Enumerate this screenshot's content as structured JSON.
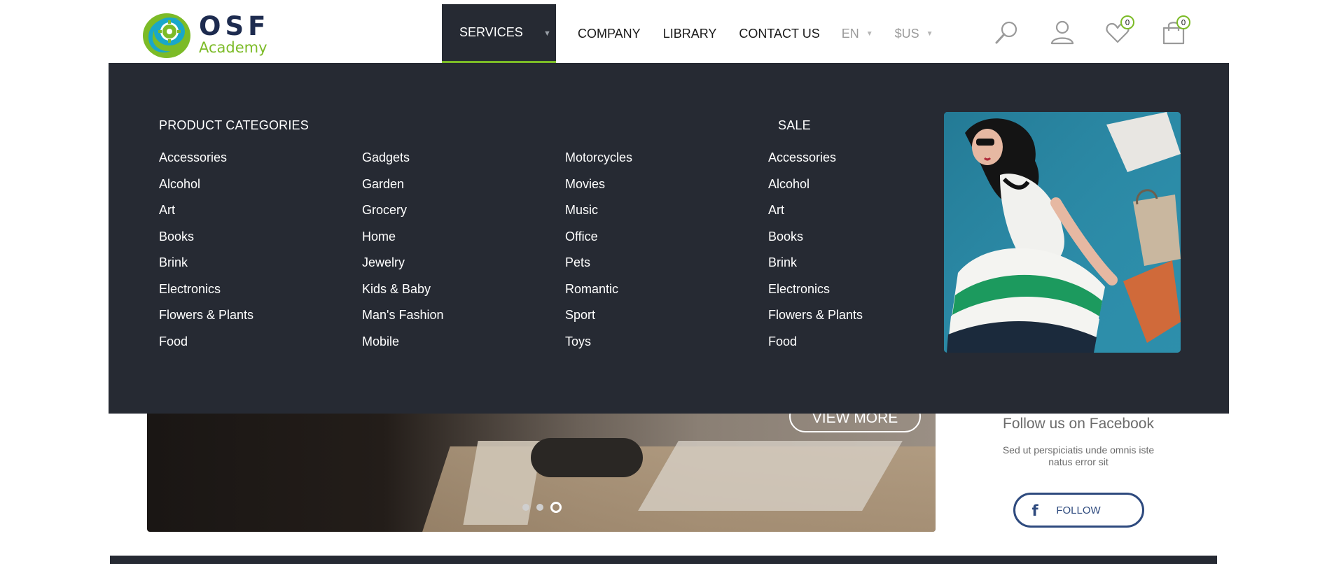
{
  "header": {
    "logo": {
      "name": "OSF",
      "sub": "Academy"
    },
    "nav": {
      "services": "SERVICES",
      "company": "COMPANY",
      "library": "LIBRARY",
      "contact": "CONTACT US",
      "language": "EN",
      "currency": "$US"
    },
    "wishlist_count": "0",
    "cart_count": "0"
  },
  "mega_menu": {
    "product_categories_title": "PRODUCT CATEGORIES",
    "sale_title": "SALE",
    "col1": [
      "Accessories",
      "Alcohol",
      "Art",
      "Books",
      "Brink",
      "Electronics",
      "Flowers & Plants",
      "Food"
    ],
    "col2": [
      "Gadgets",
      "Garden",
      "Grocery",
      "Home",
      "Jewelry",
      "Kids & Baby",
      "Man's Fashion",
      "Mobile"
    ],
    "col3": [
      "Motorcycles",
      "Movies",
      "Music",
      "Office",
      "Pets",
      "Romantic",
      "Sport",
      "Toys"
    ],
    "sale": [
      "Accessories",
      "Alcohol",
      "Art",
      "Books",
      "Brink",
      "Electronics",
      "Flowers & Plants",
      "Food"
    ]
  },
  "hero": {
    "cta": "VIEW MORE",
    "slides_total": 3,
    "active_slide": 3
  },
  "facebook": {
    "title": "Follow us on Facebook",
    "text": "Sed ut perspiciatis unde omnis iste natus error sit",
    "button": "FOLLOW"
  },
  "colors": {
    "accent": "#7cbb27",
    "dark": "#262a33",
    "brand_navy": "#1d2b4f",
    "facebook": "#2e4a7e"
  },
  "icons": [
    "search-icon",
    "user-icon",
    "heart-icon",
    "cart-icon",
    "facebook-icon",
    "chevron-down-icon"
  ]
}
